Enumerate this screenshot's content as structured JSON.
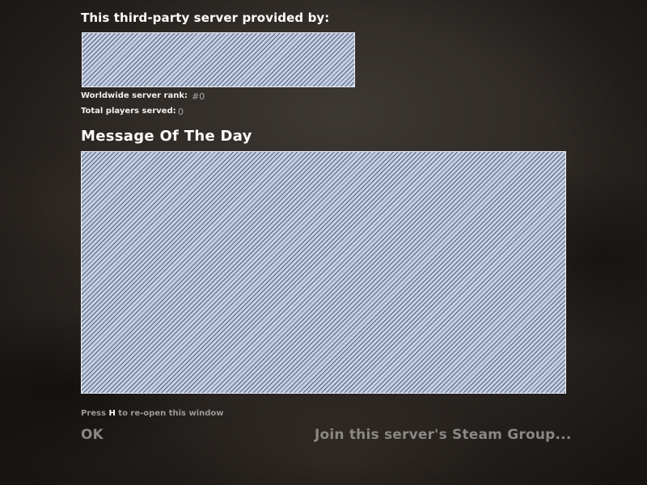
{
  "provider": {
    "title": "This third-party server provided by:"
  },
  "stats": {
    "rank_label": "Worldwide server rank:",
    "rank_value": "#0",
    "players_label": "Total players served:",
    "players_value": "0"
  },
  "motd": {
    "title": "Message Of The Day"
  },
  "hint": {
    "prefix": "Press ",
    "key": "H",
    "suffix": " to re-open this window"
  },
  "buttons": {
    "ok_label": "OK",
    "steam_group_label": "Join this server's Steam Group..."
  },
  "colors": {
    "placeholder_fill": "#c4cee4",
    "placeholder_stripe": "#5a6478",
    "button_text": "#8a8784",
    "muted_text": "#9a9a9a"
  }
}
